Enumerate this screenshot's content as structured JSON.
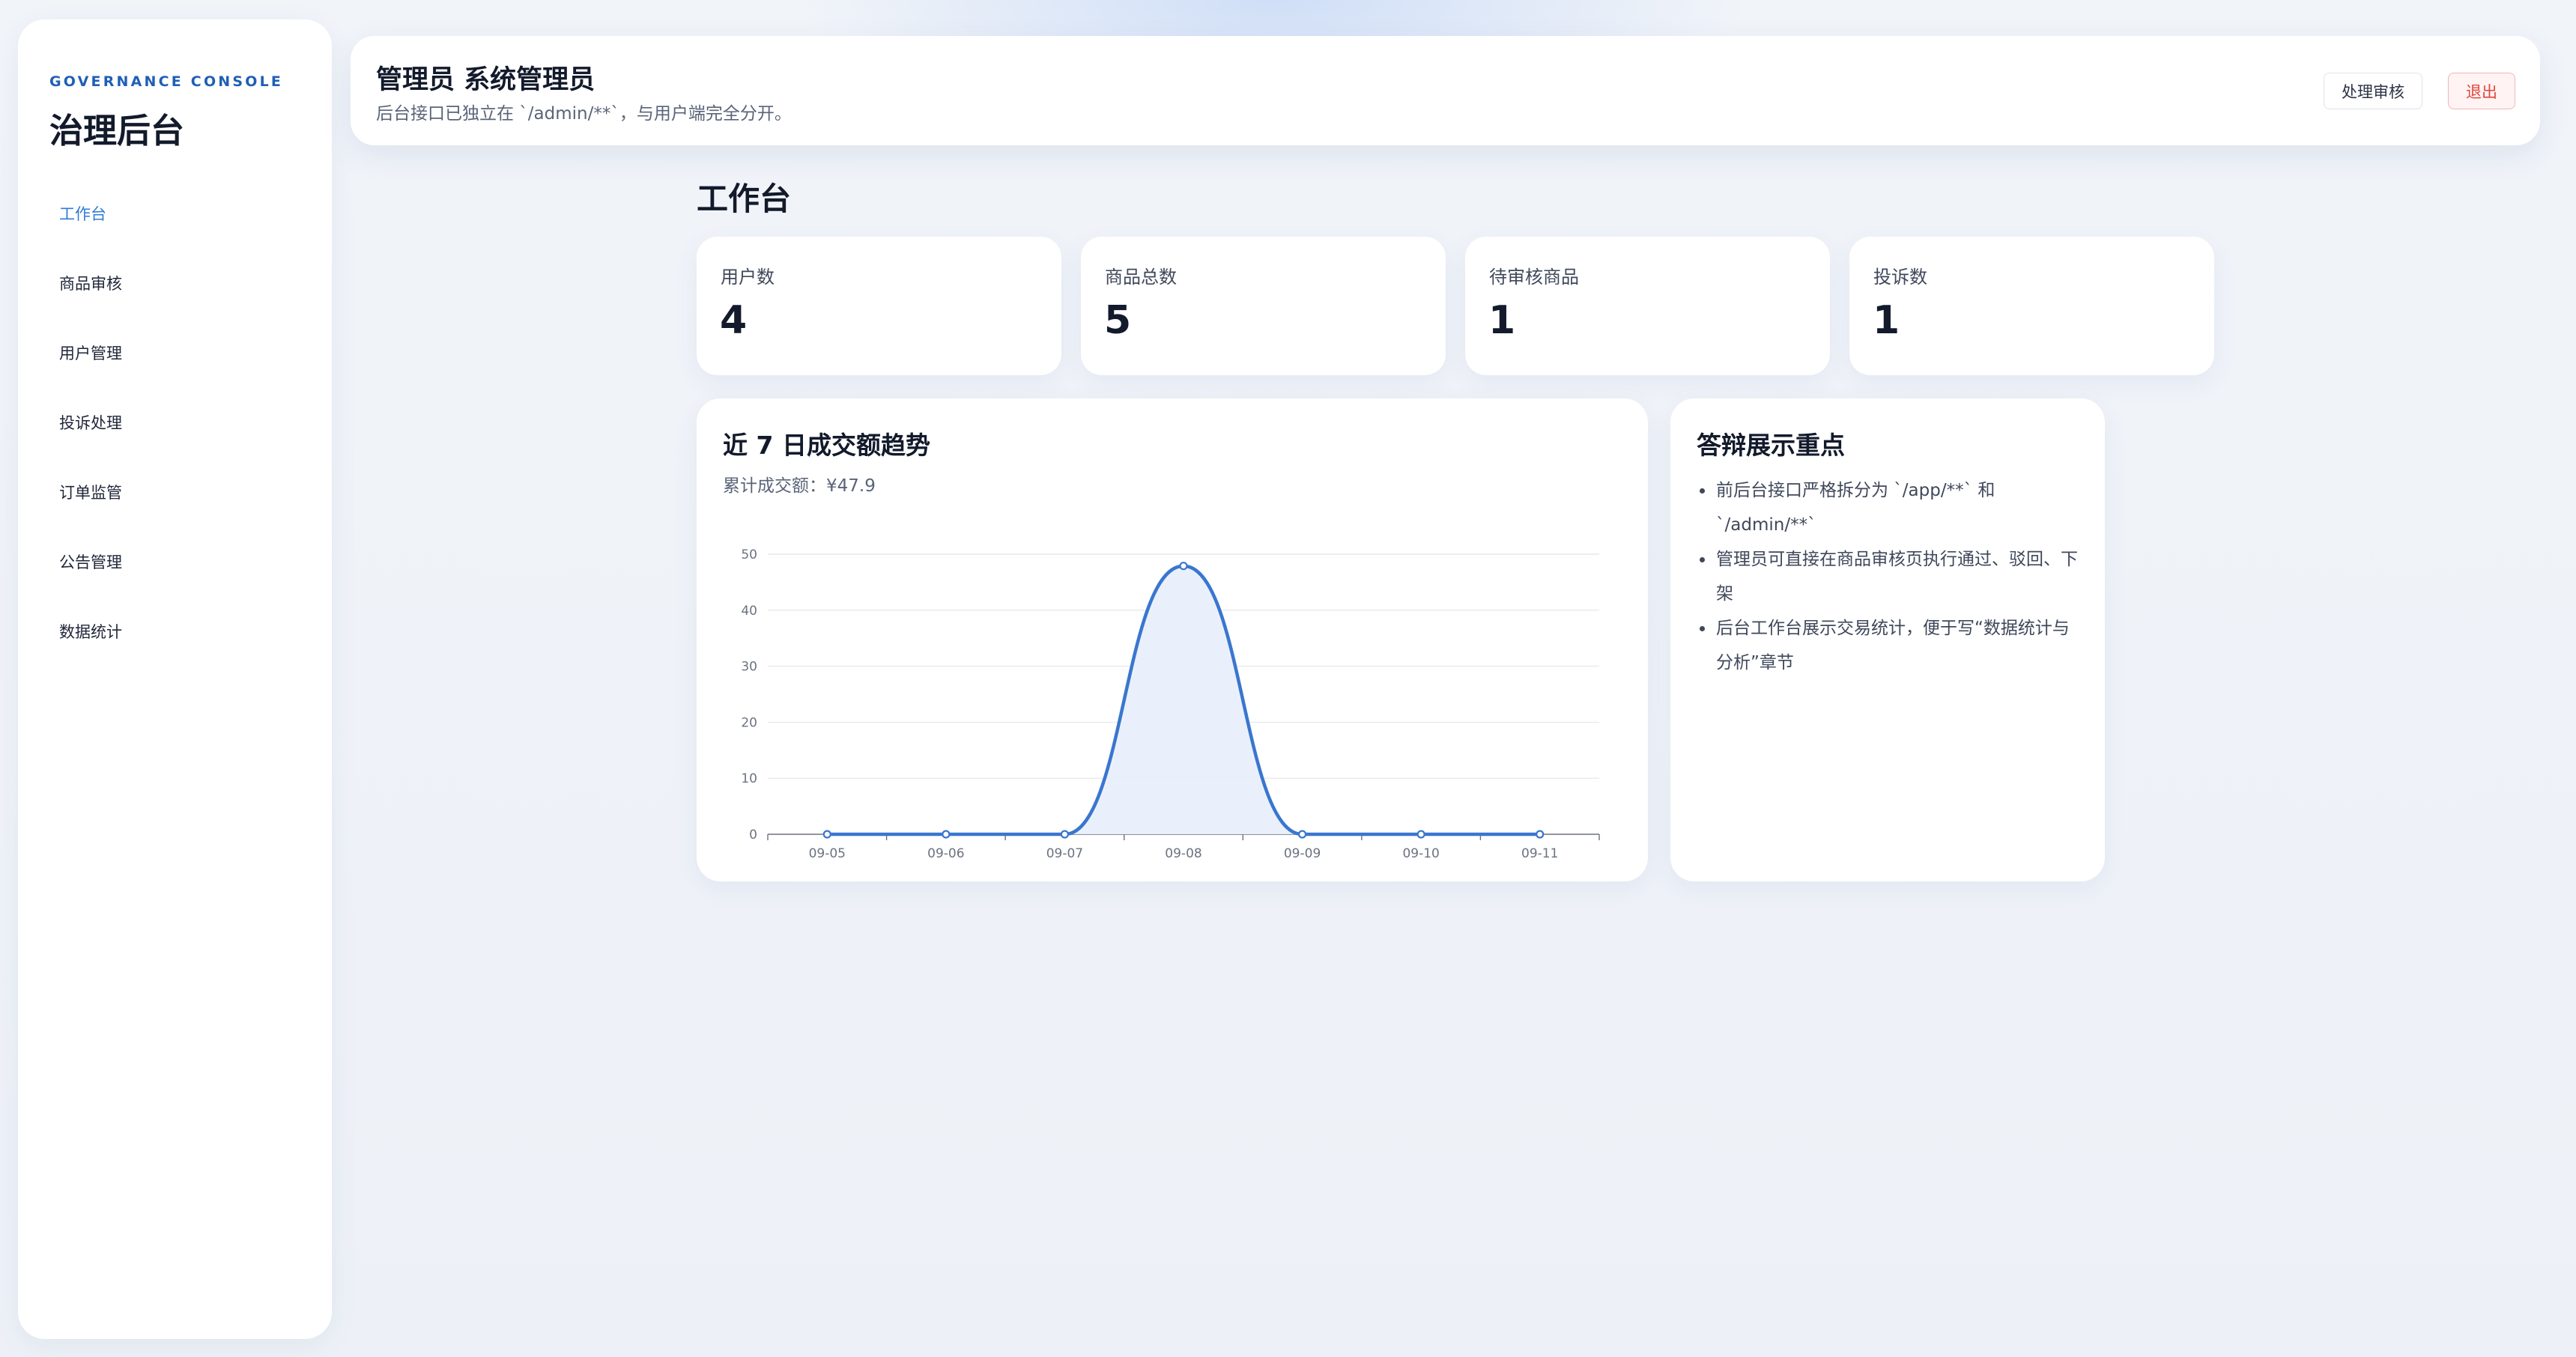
{
  "sidebar": {
    "kicker": "GOVERNANCE CONSOLE",
    "title": "治理后台",
    "items": [
      {
        "label": "工作台",
        "active": true
      },
      {
        "label": "商品审核"
      },
      {
        "label": "用户管理"
      },
      {
        "label": "投诉处理"
      },
      {
        "label": "订单监管"
      },
      {
        "label": "公告管理"
      },
      {
        "label": "数据统计"
      }
    ]
  },
  "header": {
    "title": "管理员 系统管理员",
    "subtitle": "后台接口已独立在 `/admin/**`，与用户端完全分开。",
    "review_button": "处理审核",
    "logout_button": "退出"
  },
  "main": {
    "title": "工作台",
    "stats": [
      {
        "label": "用户数",
        "value": "4"
      },
      {
        "label": "商品总数",
        "value": "5"
      },
      {
        "label": "待审核商品",
        "value": "1"
      },
      {
        "label": "投诉数",
        "value": "1"
      }
    ],
    "chart_card": {
      "title": "近 7 日成交额趋势",
      "subtitle": "累计成交额：¥47.9"
    },
    "notes_card": {
      "title": "答辩展示重点",
      "items": [
        "前后台接口严格拆分为 `/app/**` 和 `/admin/**`",
        "管理员可直接在商品审核页执行通过、驳回、下架",
        "后台工作台展示交易统计，便于写“数据统计与分析”章节"
      ]
    }
  },
  "colors": {
    "accent": "#2f7bd8",
    "line": "#3a76cf",
    "area": "#e8eefb",
    "danger": "#e0473f"
  },
  "chart_data": {
    "type": "area",
    "categories": [
      "09-05",
      "09-06",
      "09-07",
      "09-08",
      "09-09",
      "09-10",
      "09-11"
    ],
    "values": [
      0,
      0,
      0,
      47.9,
      0,
      0,
      0
    ],
    "ylim": [
      0,
      50
    ],
    "yticks": [
      0,
      10,
      20,
      30,
      40,
      50
    ],
    "grid": true,
    "smooth": true
  }
}
